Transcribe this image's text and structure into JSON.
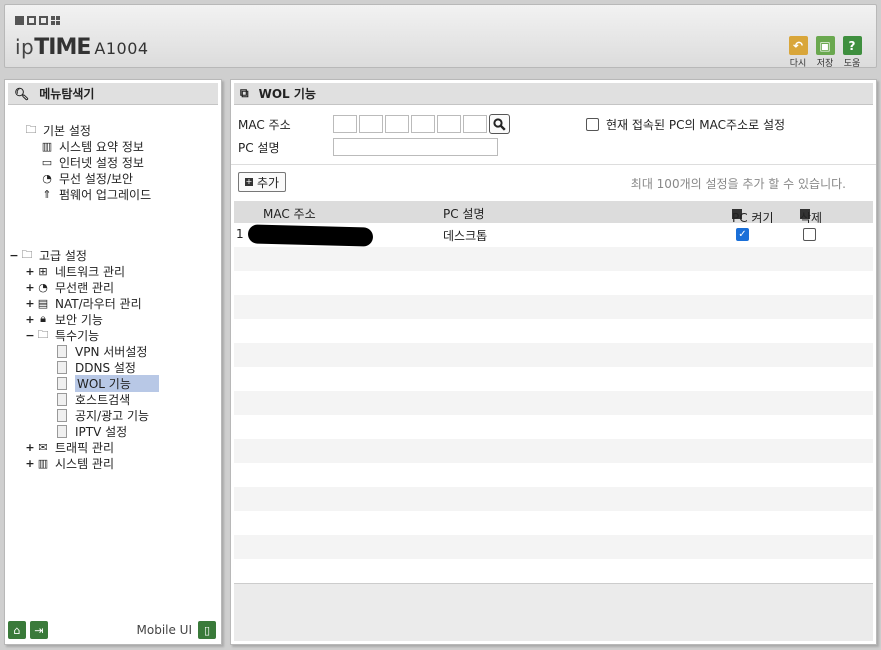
{
  "header": {
    "brand_ip": "ip",
    "brand_time": "TIME",
    "model": "A1004",
    "buttons": [
      {
        "label": "다시",
        "icon": "undo-icon",
        "color": "#d9a63a"
      },
      {
        "label": "저장",
        "icon": "save-icon",
        "color": "#6aa84f"
      },
      {
        "label": "도움",
        "icon": "help-icon",
        "color": "#3f8f3f"
      }
    ]
  },
  "sidebar": {
    "title": "메뉴탐색기",
    "basic": {
      "label": "기본 설정",
      "items": [
        "시스템 요약 정보",
        "인터넷 설정 정보",
        "무선 설정/보안",
        "펌웨어 업그레이드"
      ]
    },
    "advanced": {
      "label": "고급 설정",
      "toggle": "−",
      "items": [
        {
          "label": "네트워크 관리",
          "toggle": "+"
        },
        {
          "label": "무선랜 관리",
          "toggle": "+"
        },
        {
          "label": "NAT/라우터 관리",
          "toggle": "+"
        },
        {
          "label": "보안 기능",
          "toggle": "+"
        },
        {
          "label": "특수기능",
          "toggle": "−"
        }
      ],
      "special": [
        "VPN 서버설정",
        "DDNS 설정",
        "WOL 기능",
        "호스트검색",
        "공지/광고 기능",
        "IPTV 설정"
      ],
      "special_selected": "WOL 기능",
      "after": [
        {
          "label": "트래픽 관리",
          "toggle": "+"
        },
        {
          "label": "시스템 관리",
          "toggle": "+"
        }
      ]
    },
    "footer": {
      "mobile_label": "Mobile UI"
    }
  },
  "main": {
    "title": "WOL 기능",
    "mac_label": "MAC 주소",
    "desc_label": "PC 설명",
    "current_pc_label": "현재 접속된 PC의 MAC주소로 설정",
    "add_label": "추가",
    "limit_text": "최대 100개의 설정을 추가 할 수 있습니다.",
    "table": {
      "columns": [
        "MAC 주소",
        "PC 설명",
        "PC 켜기",
        "삭제"
      ],
      "rows": [
        {
          "index": "1",
          "mac": "",
          "desc": "데스크톱",
          "pc_on": true,
          "delete": false
        }
      ]
    }
  },
  "colors": {
    "accent": "#1a6fd8",
    "selected_bg": "#b8c8e6",
    "panel_bg": "#e0e0e0"
  }
}
